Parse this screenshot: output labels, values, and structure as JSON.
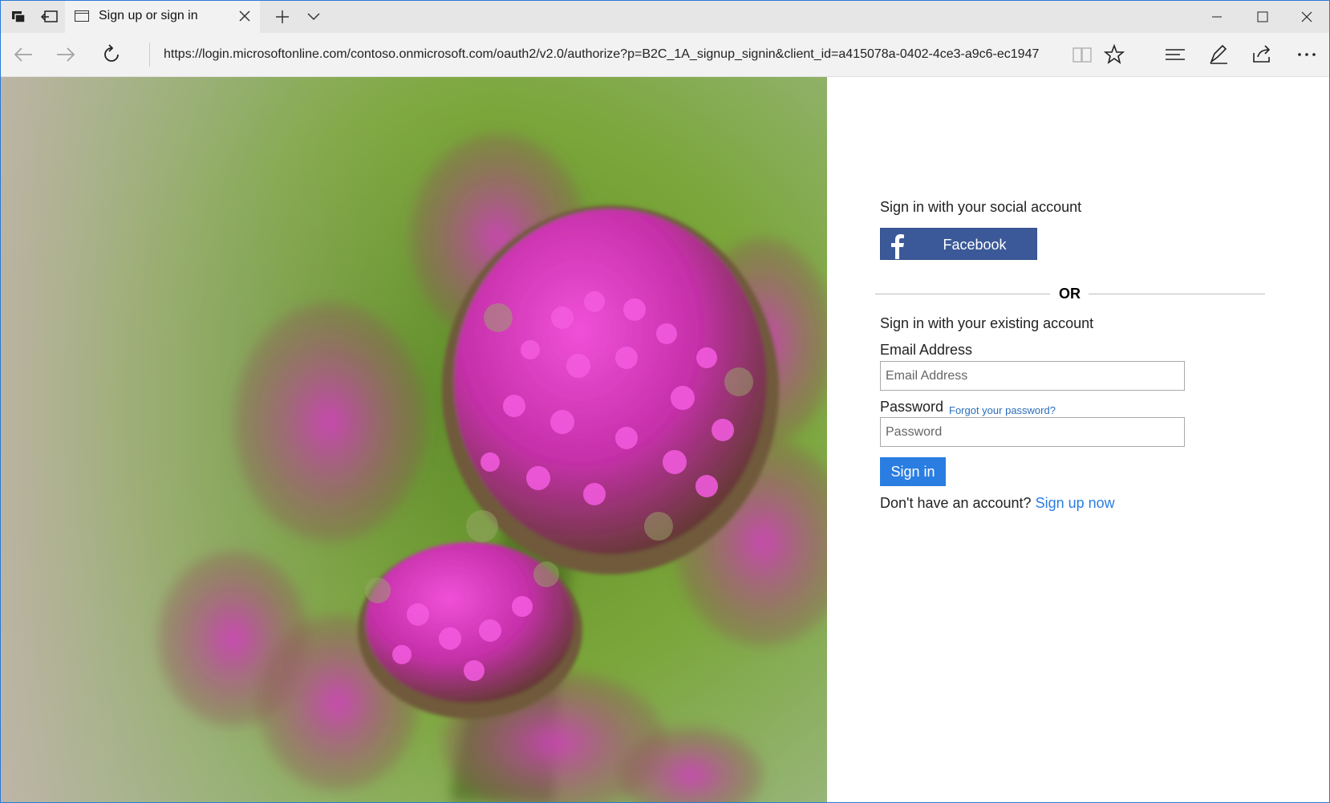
{
  "browser": {
    "tab": {
      "title": "Sign up or sign in"
    },
    "address_bar": {
      "url": "https://login.microsoftonline.com/contoso.onmicrosoft.com/oauth2/v2.0/authorize?p=B2C_1A_signup_signin&client_id=a415078a-0402-4ce3-a9c6-ec1947"
    },
    "icons": {
      "tab_actions": "tab-actions-icon",
      "set_aside": "set-aside-tabs-icon",
      "page": "page-icon",
      "close_tab": "close-icon",
      "new_tab": "plus-icon",
      "tab_preview": "chevron-down-icon",
      "minimize": "minimize-icon",
      "maximize": "maximize-icon",
      "close_window": "close-icon",
      "back": "back-arrow-icon",
      "forward": "forward-arrow-icon",
      "refresh": "refresh-icon",
      "reading_view": "book-icon",
      "favorite": "star-icon",
      "hub": "hub-icon",
      "web_note": "pen-icon",
      "share": "share-icon",
      "more": "more-icon"
    },
    "accent": "#2b79d6"
  },
  "signin": {
    "social_heading": "Sign in with your social account",
    "facebook_label": "Facebook",
    "or_label": "OR",
    "existing_heading": "Sign in with your existing account",
    "email_label": "Email Address",
    "email_placeholder": "Email Address",
    "email_value": "",
    "password_label": "Password",
    "password_placeholder": "Password",
    "password_value": "",
    "forgot_link": "Forgot your password?",
    "signin_button": "Sign in",
    "no_account_text": "Don't have an account?",
    "signup_link": "Sign up now",
    "colors": {
      "facebook": "#3b5998",
      "primary": "#2a7de1",
      "link": "#2a6ebb"
    }
  },
  "hero_image": {
    "subject": "pink-flower-buds-photo"
  }
}
